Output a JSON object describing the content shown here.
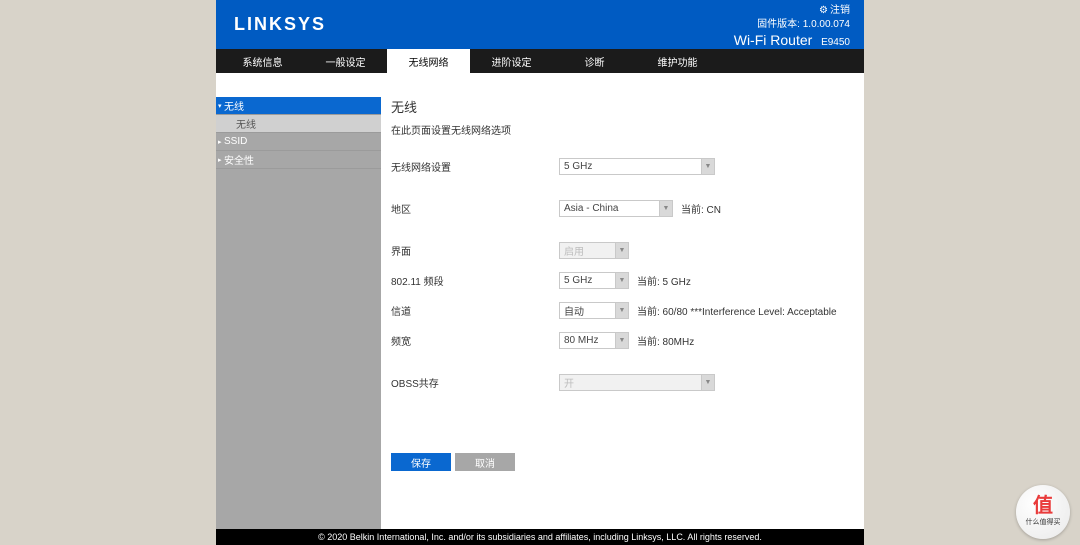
{
  "header": {
    "brand": "LINKSYS",
    "logout_icon": "⚙",
    "logout_label": "注销",
    "firmware_label": "固件版本: 1.0.00.074",
    "router_label": "Wi-Fi Router",
    "model": "E9450"
  },
  "tabs": [
    {
      "label": "系统信息"
    },
    {
      "label": "一般设定"
    },
    {
      "label": "无线网络",
      "active": true
    },
    {
      "label": "进阶设定"
    },
    {
      "label": "诊断"
    },
    {
      "label": "维护功能"
    }
  ],
  "sidebar": [
    {
      "label": "无线",
      "type": "head",
      "active": true
    },
    {
      "label": "无线",
      "type": "sub"
    },
    {
      "label": "SSID",
      "type": "head"
    },
    {
      "label": "安全性",
      "type": "head"
    }
  ],
  "page": {
    "title": "无线",
    "desc": "在此页面设置无线网络选项"
  },
  "form": {
    "band_label": "无线网络设置",
    "band_value": "5 GHz",
    "region_label": "地区",
    "region_value": "Asia - China",
    "region_after": "当前: CN",
    "iface_label": "界面",
    "iface_value": "启用",
    "freq_label": "802.11 频段",
    "freq_value": "5 GHz",
    "freq_after": "当前: 5 GHz",
    "channel_label": "信道",
    "channel_value": "自动",
    "channel_after": "当前: 60/80 ***Interference Level: Acceptable",
    "bw_label": "频宽",
    "bw_value": "80 MHz",
    "bw_after": "当前: 80MHz",
    "obss_label": "OBSS共存",
    "obss_value": "开"
  },
  "actions": {
    "save": "保存",
    "cancel": "取消"
  },
  "footer": "© 2020 Belkin International, Inc. and/or its subsidiaries and affiliates, including Linksys, LLC. All rights reserved.",
  "badge": {
    "mark": "值",
    "text": "什么值得买"
  }
}
